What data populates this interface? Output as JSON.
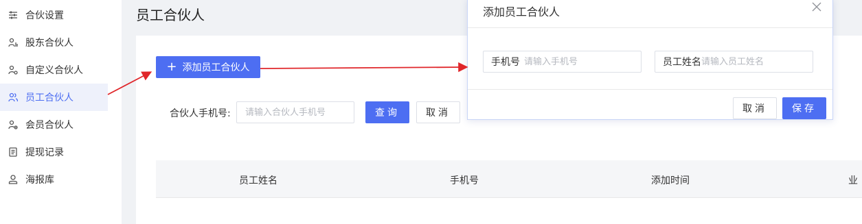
{
  "sidebar": {
    "items": [
      {
        "label": "合伙设置",
        "icon": "sliders-icon",
        "active": false
      },
      {
        "label": "股东合伙人",
        "icon": "shareholder-icon",
        "active": false
      },
      {
        "label": "自定义合伙人",
        "icon": "custom-partner-icon",
        "active": false
      },
      {
        "label": "员工合伙人",
        "icon": "users-icon",
        "active": true
      },
      {
        "label": "会员合伙人",
        "icon": "member-icon",
        "active": false
      },
      {
        "label": "提现记录",
        "icon": "document-icon",
        "active": false
      },
      {
        "label": "海报库",
        "icon": "person-icon",
        "active": false
      }
    ]
  },
  "page": {
    "title": "员工合伙人",
    "add_button": "添加员工合伙人",
    "filter": {
      "label": "合伙人手机号:",
      "placeholder": "请输入合伙人手机号",
      "query_button": "查询",
      "cancel_button": "取消"
    },
    "table": {
      "columns": [
        "员工姓名",
        "手机号",
        "添加时间",
        "业"
      ]
    }
  },
  "modal": {
    "title": "添加员工合伙人",
    "phone_label": "手机号",
    "phone_placeholder": "请输入手机号",
    "name_label": "员工姓名",
    "name_placeholder": "请输入员工姓名",
    "cancel_button": "取消",
    "save_button": "保存"
  },
  "colors": {
    "accent": "#4d6ef2",
    "annotation_arrow": "#e0262a"
  }
}
